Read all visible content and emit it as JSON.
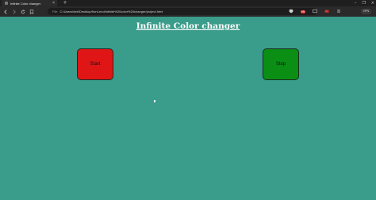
{
  "browser": {
    "tab_title": "Infinite Color changer",
    "tab_close": "×",
    "new_tab": "+",
    "window_controls": [
      "–",
      "❐",
      "×"
    ],
    "url_prefix": "File",
    "url": "C:/Users/deb/Desktop/front-end/infinite%20color%20changer/project.html",
    "extension_badge": "99",
    "vpn_label": "VPN"
  },
  "page": {
    "title": "Infinite Color changer",
    "start_label": "Start",
    "stop_label": "Stop"
  },
  "colors": {
    "background": "#3a9c8a",
    "start_button": "#e01616",
    "stop_button": "#0a8f14"
  }
}
